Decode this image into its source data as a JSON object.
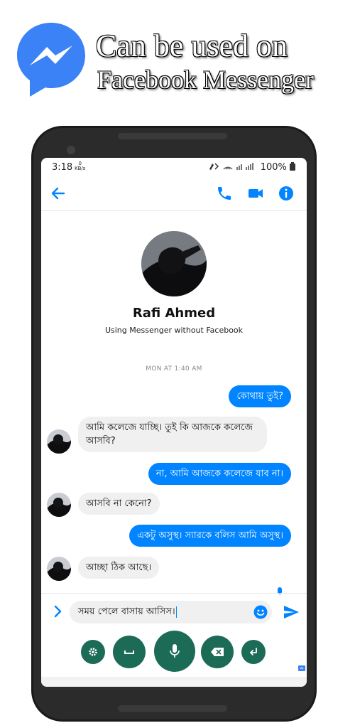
{
  "promo": {
    "line1": "Can be used on",
    "line2": "Facebook Messenger",
    "logo_icon": "messenger-logo-icon",
    "brand_color": "#3b82f6"
  },
  "status_bar": {
    "time": "3:18",
    "net_speed_value": "0",
    "net_speed_unit": "KB/s",
    "battery": "100%"
  },
  "app_bar": {
    "back_icon": "arrow-back-icon",
    "actions": [
      "phone-icon",
      "video-camera-icon",
      "info-icon"
    ],
    "accent": "#0084ff"
  },
  "profile": {
    "name": "Rafi Ahmed",
    "subtitle": "Using Messenger without Facebook"
  },
  "conversation": {
    "timestamp": "MON AT 1:40 AM",
    "messages": [
      {
        "from": "me",
        "text": "কোথায় তুই?"
      },
      {
        "from": "them",
        "text": "আমি কলেজে যাচ্ছি। তুই কি আজকে কলেজে আসবি?"
      },
      {
        "from": "me",
        "text": "না, আমি আজকে কলেজে যাব না।"
      },
      {
        "from": "them",
        "text": "আসবি না কেনো?"
      },
      {
        "from": "me",
        "text": "একটু অসুস্থ। স্যারকে বলিস আমি অসুস্থ।"
      },
      {
        "from": "them",
        "text": "আচ্ছা ঠিক আছে।"
      }
    ]
  },
  "composer": {
    "draft": "সময় পেলে বাসায় আসিস।",
    "expand_icon": "chevron-right-icon",
    "emoji_icon": "emoji-icon",
    "send_icon": "send-icon"
  },
  "keyboard_toolbar": {
    "buttons": [
      "settings-icon",
      "space-icon",
      "microphone-icon",
      "backspace-icon",
      "enter-icon"
    ],
    "color": "#1b6b57"
  }
}
